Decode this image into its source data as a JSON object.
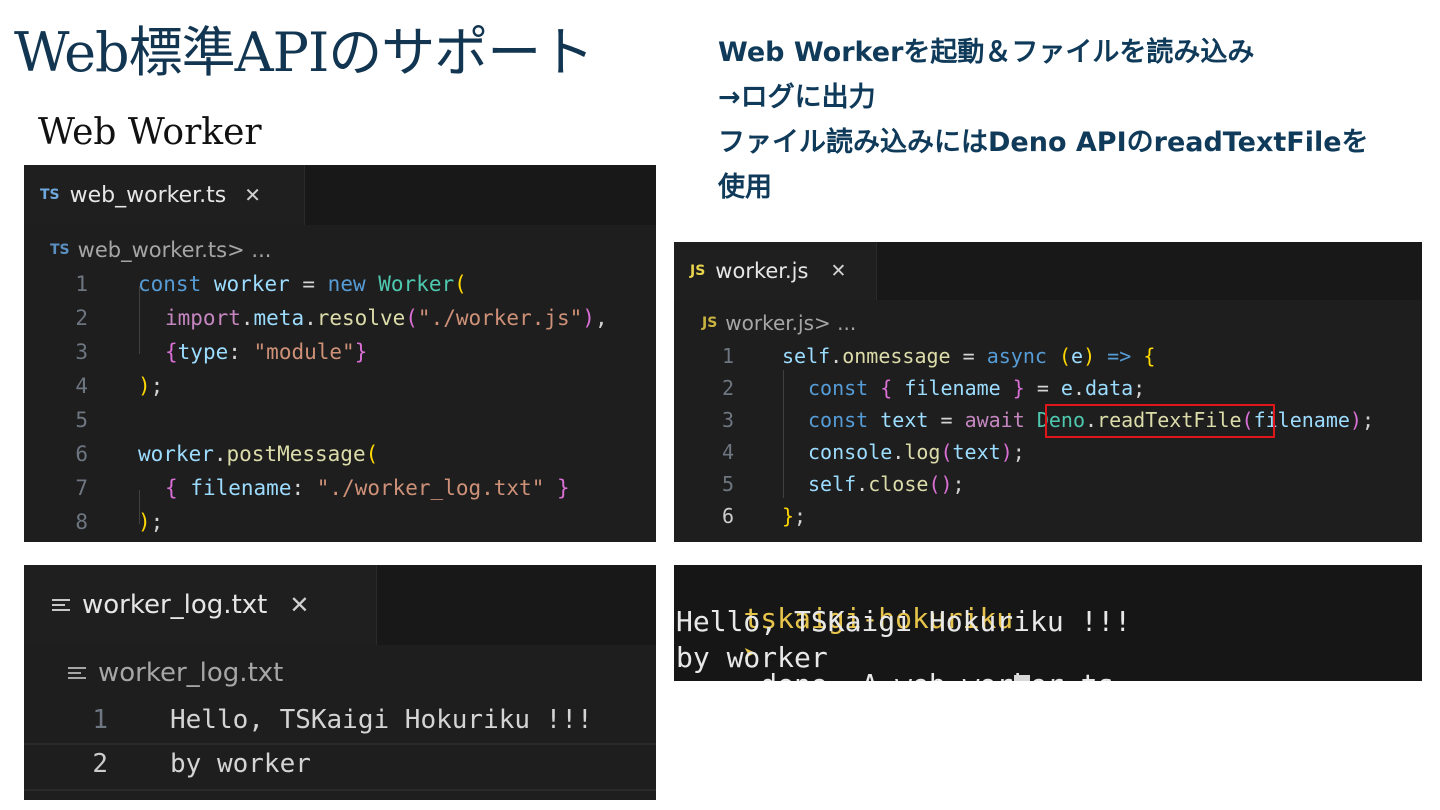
{
  "title": "Web標準APIのサポート",
  "subtitle": "Web Worker",
  "description": [
    "Web Workerを起動＆ファイルを読み込み",
    "→ログに出力",
    "ファイル読み込みにはDeno APIのreadTextFileを",
    "使用"
  ],
  "editor_ts": {
    "badge": "TS",
    "tab_label": "web_worker.ts",
    "close_glyph": "✕",
    "breadcrumb_file": "web_worker.ts",
    "breadcrumb_rest": " > ...",
    "line_numbers": [
      "1",
      "2",
      "3",
      "4",
      "5",
      "6",
      "7",
      "8"
    ]
  },
  "editor_js": {
    "badge": "JS",
    "tab_label": "worker.js",
    "close_glyph": "✕",
    "breadcrumb_file": "worker.js",
    "breadcrumb_rest": " > ...",
    "line_numbers": [
      "1",
      "2",
      "3",
      "4",
      "5",
      "6"
    ],
    "active_line": "6",
    "highlight_text": "Deno.readTextFile"
  },
  "editor_log": {
    "tab_label": "worker_log.txt",
    "close_glyph": "✕",
    "breadcrumb_file": "worker_log.txt",
    "line_numbers": [
      "1",
      "2"
    ],
    "lines": [
      "Hello, TSKaigi Hokuriku !!!",
      "by worker"
    ]
  },
  "terminal": {
    "prompt": "tskaigi-hokuriku",
    "arrow": "➤",
    "command": " deno -A web_worker.ts",
    "output": [
      "Hello, TSKaigi Hokuriku !!!",
      "by worker"
    ]
  },
  "colors": {
    "title": "#123651",
    "description": "#0f3a59",
    "editor_bg": "#1e1e1e",
    "highlight_box": "#e0161a",
    "prompt": "#e6c34a"
  }
}
